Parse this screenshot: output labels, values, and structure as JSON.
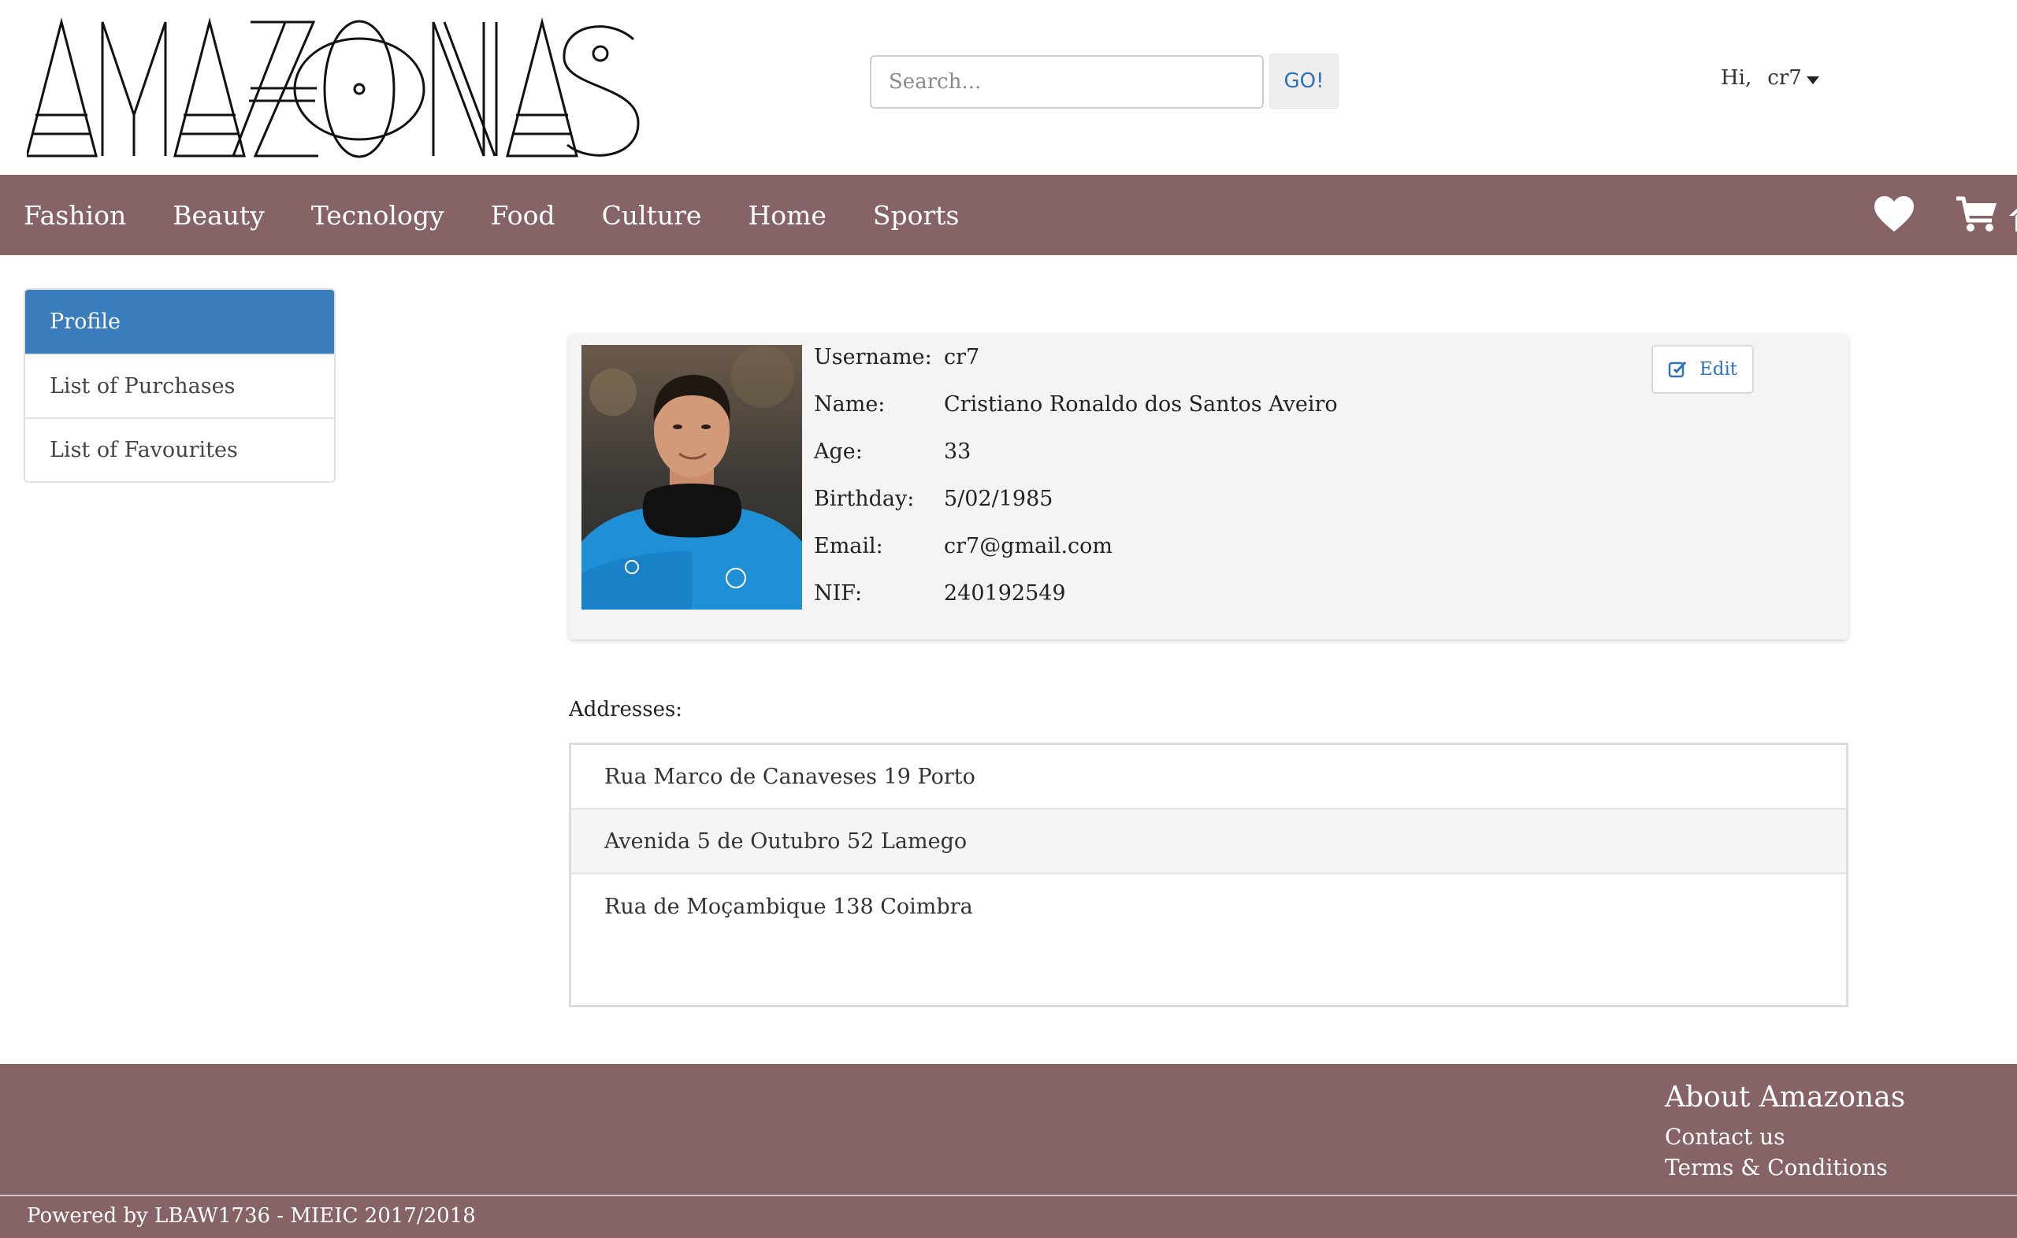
{
  "header": {
    "logo_text": "AMAZONAS",
    "search_placeholder": "Search...",
    "search_button": "GO!",
    "greeting": "Hi,",
    "username": "cr7"
  },
  "nav": {
    "categories": [
      "Fashion",
      "Beauty",
      "Tecnology",
      "Food",
      "Culture",
      "Home",
      "Sports"
    ],
    "icons": [
      "heart-icon",
      "cart-icon",
      "home-icon"
    ]
  },
  "sidebar": {
    "items": [
      {
        "label": "Profile",
        "active": true
      },
      {
        "label": "List of Purchases",
        "active": false
      },
      {
        "label": "List of Favourites",
        "active": false
      }
    ]
  },
  "profile": {
    "fields": [
      {
        "label": "Username:",
        "value": "cr7"
      },
      {
        "label": "Name:",
        "value": "Cristiano Ronaldo dos Santos Aveiro"
      },
      {
        "label": "Age:",
        "value": "33"
      },
      {
        "label": "Birthday:",
        "value": "5/02/1985"
      },
      {
        "label": "Email:",
        "value": "cr7@gmail.com"
      },
      {
        "label": "NIF:",
        "value": "240192549"
      }
    ],
    "edit_label": "Edit"
  },
  "addresses": {
    "label": "Addresses:",
    "items": [
      "Rua Marco de Canaveses 19 Porto",
      "Avenida 5 de Outubro 52 Lamego",
      "Rua de Moçambique 138 Coimbra"
    ]
  },
  "footer": {
    "about_title": "About Amazonas",
    "links": [
      "Contact us",
      "Terms & Conditions"
    ],
    "powered_by": "Powered by LBAW1736 - MIEIC 2017/2018"
  },
  "colors": {
    "nav_bg": "#866366",
    "accent_blue": "#3a7dbd",
    "link_blue": "#2f72b8"
  }
}
